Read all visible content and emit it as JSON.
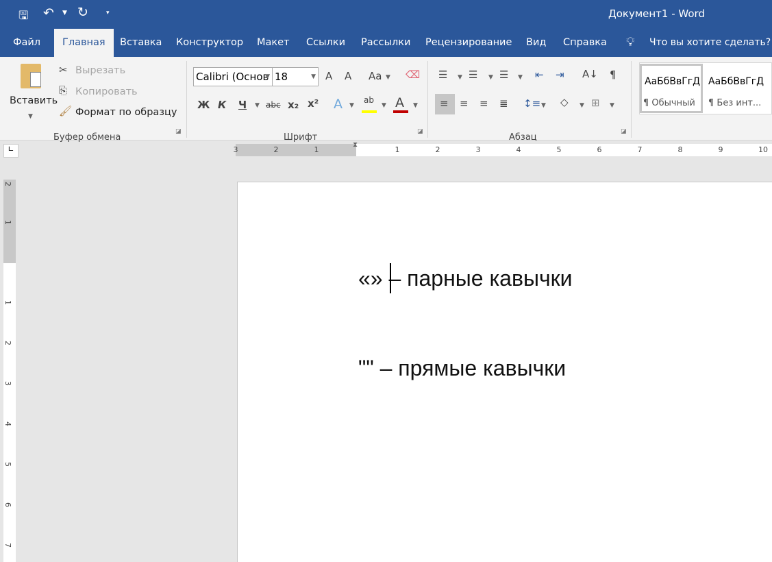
{
  "title": "Документ1  -  Word",
  "quick_access": {
    "save": "save-icon",
    "undo": "undo-icon",
    "redo": "redo-icon",
    "customize": "customize-icon"
  },
  "tabs": [
    "Файл",
    "Главная",
    "Вставка",
    "Конструктор",
    "Макет",
    "Ссылки",
    "Рассылки",
    "Рецензирование",
    "Вид",
    "Справка"
  ],
  "active_tab": "Главная",
  "tell_me": "Что вы хотите сделать?",
  "clipboard": {
    "paste": "Вставить",
    "cut": "Вырезать",
    "copy": "Копировать",
    "format_painter": "Формат по образцу",
    "group": "Буфер обмена"
  },
  "font": {
    "name": "Calibri (Основ",
    "size": "18",
    "bold": "Ж",
    "italic": "К",
    "underline": "Ч",
    "strike": "abc",
    "sub": "x₂",
    "sup": "x²",
    "case": "Aa",
    "grow": "A",
    "shrink": "A",
    "group": "Шрифт"
  },
  "paragraph": {
    "group": "Абзац",
    "pilcrow": "¶"
  },
  "styles": [
    {
      "preview": "АаБбВвГгД",
      "name": "¶ Обычный"
    },
    {
      "preview": "АаБбВвГгД",
      "name": "¶ Без инт..."
    }
  ],
  "ruler": {
    "left": [
      "3",
      "2",
      "1"
    ],
    "right": [
      "1",
      "2",
      "3",
      "4",
      "5",
      "6",
      "7",
      "8",
      "9",
      "10"
    ],
    "vertical_top": [
      "2",
      "1"
    ],
    "vertical": [
      "1",
      "2",
      "3",
      "4",
      "5",
      "6",
      "7"
    ]
  },
  "document": {
    "lines": [
      "«» – парные кавычки",
      "\"\" – прямые кавычки"
    ]
  },
  "colors": {
    "brand": "#2b579a",
    "highlight": "#ffff00",
    "font_color": "#c00000"
  }
}
